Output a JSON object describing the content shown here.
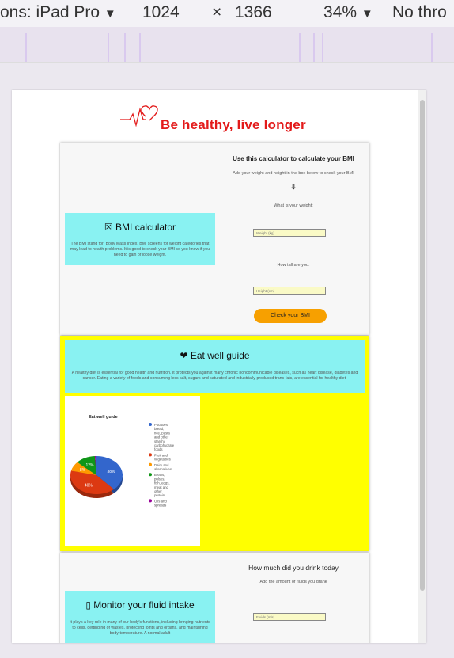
{
  "devtools": {
    "device": "ons: iPad Pro",
    "dropdown_icon": "caret-down-icon",
    "width": "1024",
    "times": "×",
    "height": "1366",
    "zoom": "34%",
    "throttle": "No thro"
  },
  "site": {
    "title": "Be healthy, live longer",
    "logo_icon": "heartbeat-icon",
    "logo_color": "#e31b1b"
  },
  "bmi": {
    "heading": "BMI calculator",
    "icon": "scale-icon",
    "description": "The BMI stand for: Body Mass Index. BMI screens for weight categories that may lead to health problems. It is good to check your BMI so you know if you need to gain or loose weight.",
    "right_title": "Use this calculator to calculate your BMI",
    "instructions": "Add your weight and height in the box below to check your BMI",
    "arrow": "⇩",
    "weight_label": "What is your weight:",
    "weight_placeholder": "Weight (kg)",
    "height_label": "How tall are you:",
    "height_placeholder": "Height (cm)",
    "button": "Check your BMI",
    "button_color": "#f7a000"
  },
  "eat": {
    "heading": "Eat well guide",
    "icon": "heart-pulse-icon",
    "description": "A healthy diet is essential for good health and nutrition. It protects you against many chronic noncommunicable diseases, such as heart disease, diabetes and cancer. Eating a variety of foods and consuming less salt, sugars and saturated and industrially-produced trans-fats, are essential for healthy diet.",
    "bg_color": "#ffff00"
  },
  "fluid": {
    "heading": "Monitor your fluid intake",
    "icon": "glass-icon",
    "description": "It plays a key role in many of our body's functions, including bringing nutrients to cells, getting rid of wastes, protecting joints and organs, and maintaining body temperature. A normal adult",
    "right_title": "How much did you drink today",
    "instructions": "Add the amount of fluids you drank",
    "input_placeholder": "Fluids (mls)"
  },
  "chart_data": {
    "type": "pie",
    "title": "Eat well guide",
    "series": [
      {
        "name": "Potatoes, bread, rice, pasta and other starchy carbohydrate foods",
        "value": 38,
        "label": "38%",
        "color": "#3366cc"
      },
      {
        "name": "Fruit and vegetables",
        "value": 40,
        "label": "40%",
        "color": "#dc3912"
      },
      {
        "name": "Dairy and alternatives",
        "value": 8,
        "label": "8%",
        "color": "#ff9900"
      },
      {
        "name": "Beans, pulses, fish, eggs, meat and other protein",
        "value": 12,
        "label": "12%",
        "color": "#109618"
      },
      {
        "name": "Oils and spreads",
        "value": 1,
        "label": "",
        "color": "#990099"
      }
    ],
    "legend_position": "right"
  }
}
